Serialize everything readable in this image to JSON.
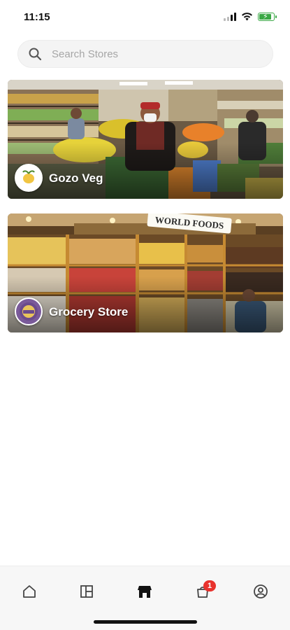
{
  "status_bar": {
    "time": "11:15"
  },
  "search": {
    "placeholder": "Search Stores",
    "value": ""
  },
  "stores": [
    {
      "name": "Gozo Veg"
    },
    {
      "name": "Grocery Store",
      "signage": "WORLD FOODS"
    }
  ],
  "bottom_nav": {
    "items": [
      "home-icon",
      "catalog-icon",
      "store-icon",
      "cart-icon",
      "profile-icon"
    ],
    "active": "store-icon",
    "cart_badge": "1"
  },
  "colors": {
    "badge": "#e8322d",
    "battery": "#3aa845"
  }
}
